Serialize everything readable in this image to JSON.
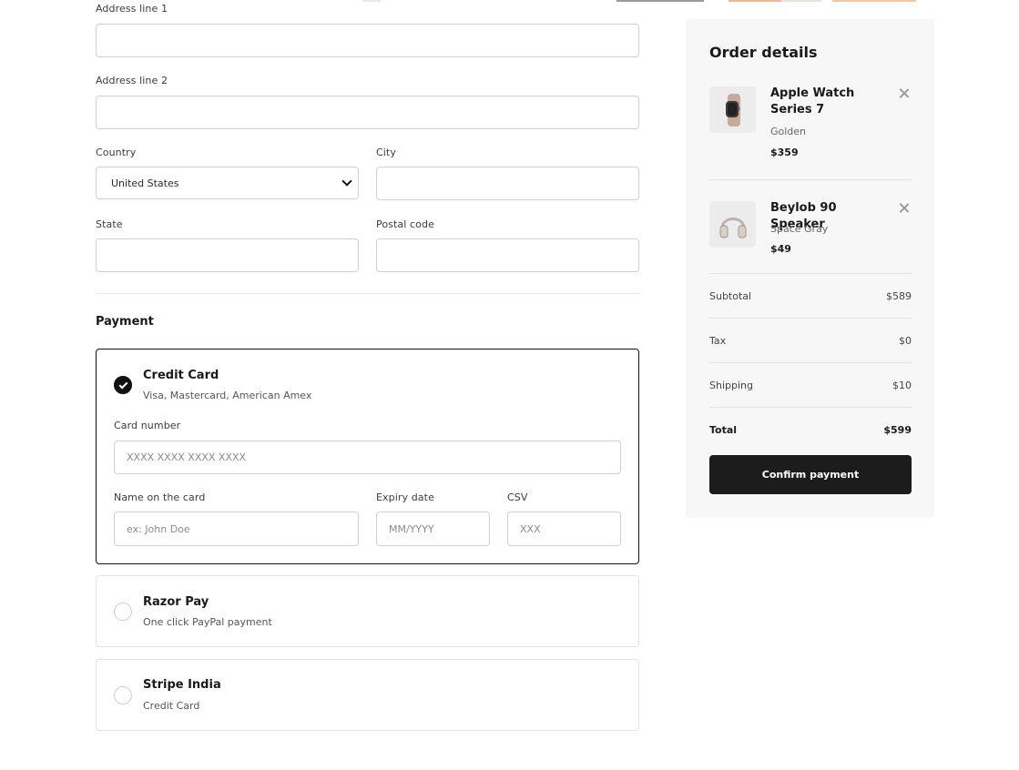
{
  "address": {
    "line1_label": "Address line 1",
    "line1_value": "",
    "line2_label": "Address line 2",
    "line2_value": "",
    "country_label": "Country",
    "country_value": "United States",
    "city_label": "City",
    "city_value": "",
    "state_label": "State",
    "state_value": "",
    "postal_label": "Postal code",
    "postal_value": ""
  },
  "payment": {
    "title": "Payment",
    "methods": [
      {
        "name": "Credit Card",
        "description": "Visa, Mastercard, American Amex",
        "selected": true
      },
      {
        "name": "Razor Pay",
        "description": "One click PayPal payment",
        "selected": false
      },
      {
        "name": "Stripe India",
        "description": "Credit Card",
        "selected": false
      }
    ],
    "card_number_label": "Card number",
    "card_number_placeholder": "XXXX XXXX XXXX XXXX",
    "name_label": "Name on the card",
    "name_placeholder": "ex: John Doe",
    "expiry_label": "Expiry date",
    "expiry_placeholder": "MM/YYYY",
    "csv_label": "CSV",
    "csv_placeholder": "XXX"
  },
  "order": {
    "title": "Order details",
    "items": [
      {
        "name": "Apple Watch Series 7",
        "variant": "Golden",
        "price": "$359",
        "icon": "watch-icon"
      },
      {
        "name": "Beylob 90 Speaker",
        "variant": "Space Gray",
        "price": "$49",
        "icon": "headphones-icon"
      }
    ],
    "summary": {
      "subtotal_label": "Subtotal",
      "subtotal_value": "$589",
      "tax_label": "Tax",
      "tax_value": "$0",
      "shipping_label": "Shipping",
      "shipping_value": "$10",
      "total_label": "Total",
      "total_value": "$599"
    },
    "confirm_label": "Confirm payment"
  },
  "colors": {
    "accent": "#1c1c1c",
    "panel_bg": "#f7f7f7",
    "border": "#cfcfcf"
  }
}
